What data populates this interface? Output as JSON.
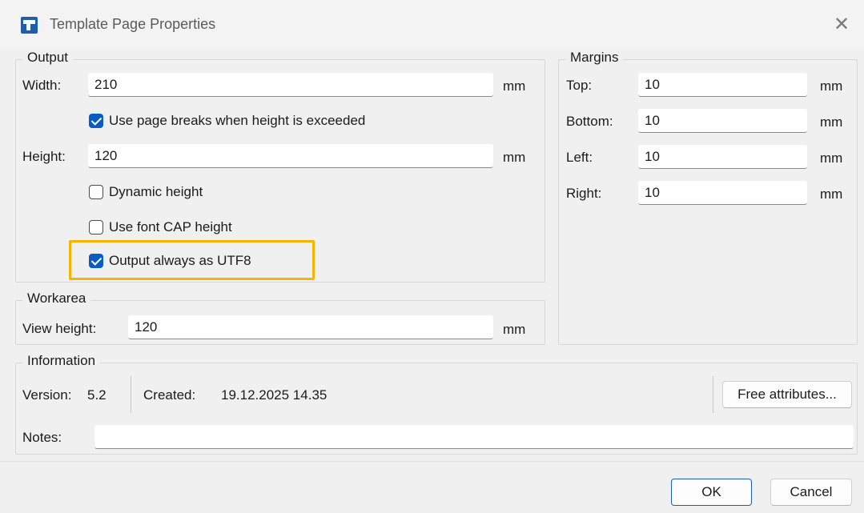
{
  "window": {
    "title": "Template Page Properties",
    "close_glyph": "✕"
  },
  "output": {
    "legend": "Output",
    "width_label": "Width:",
    "width_value": "210",
    "width_unit": "mm",
    "page_breaks_label": "Use page breaks when height is exceeded",
    "page_breaks_checked": true,
    "height_label": "Height:",
    "height_value": "120",
    "height_unit": "mm",
    "dynamic_height_label": "Dynamic height",
    "dynamic_height_checked": false,
    "font_cap_label": "Use font CAP height",
    "font_cap_checked": false,
    "utf8_label": "Output always as UTF8",
    "utf8_checked": true
  },
  "margins": {
    "legend": "Margins",
    "top_label": "Top:",
    "top_value": "10",
    "bottom_label": "Bottom:",
    "bottom_value": "10",
    "left_label": "Left:",
    "left_value": "10",
    "right_label": "Right:",
    "right_value": "10",
    "unit": "mm"
  },
  "workarea": {
    "legend": "Workarea",
    "view_height_label": "View height:",
    "view_height_value": "120",
    "unit": "mm"
  },
  "information": {
    "legend": "Information",
    "version_label": "Version:",
    "version_value": "5.2",
    "created_label": "Created:",
    "created_value": "19.12.2025 14.35",
    "free_attributes_label": "Free attributes...",
    "notes_label": "Notes:",
    "notes_value": ""
  },
  "buttons": {
    "ok_label": "OK",
    "cancel_label": "Cancel"
  },
  "colors": {
    "accent": "#0a5cc2",
    "highlight": "#f4b400"
  }
}
